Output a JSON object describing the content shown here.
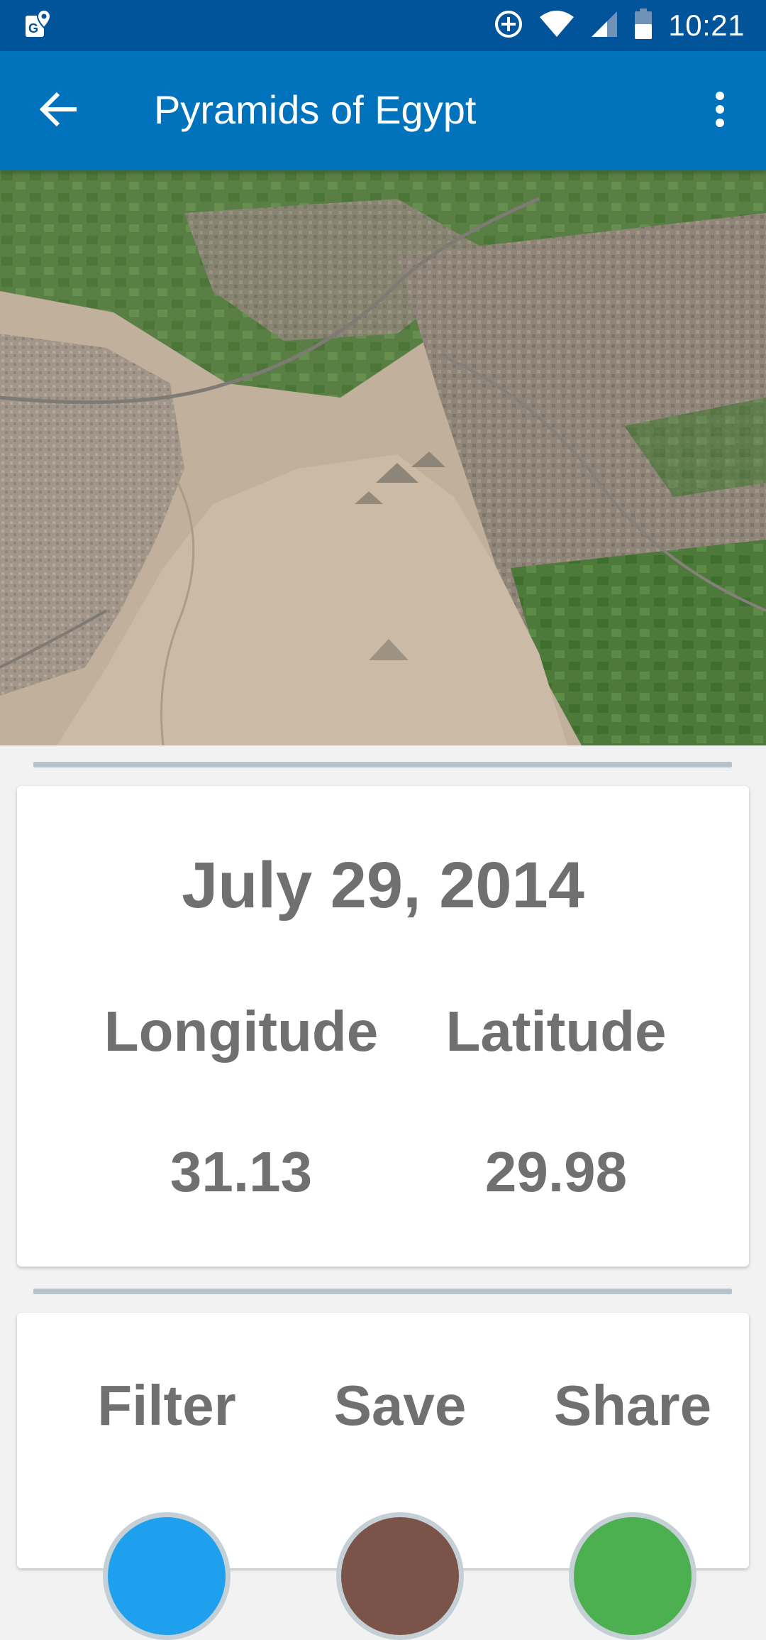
{
  "status_bar": {
    "time": "10:21",
    "icons": [
      "maps-notification-icon",
      "data-saver-icon",
      "wifi-icon",
      "cell-signal-icon",
      "battery-icon"
    ]
  },
  "app_bar": {
    "title": "Pyramids of Egypt",
    "back_icon": "back-arrow-icon",
    "menu_icon": "more-vert-icon",
    "color": "#0173bd"
  },
  "info": {
    "date": "July 29, 2014",
    "longitude_label": "Longitude",
    "latitude_label": "Latitude",
    "longitude_value": "31.13",
    "latitude_value": "29.98"
  },
  "actions": {
    "filter_label": "Filter",
    "save_label": "Save",
    "share_label": "Share",
    "filter_color": "#1ea0ee",
    "save_color": "#7a5448",
    "share_color": "#4caf50"
  }
}
